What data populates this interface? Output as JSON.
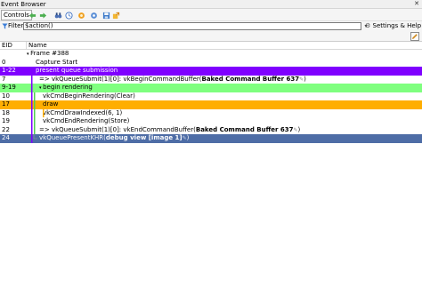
{
  "window": {
    "title": "Event Browser",
    "close_glyph": "✕"
  },
  "toolbar": {
    "controls_label": "Controls",
    "icons": [
      "arrow-left-icon",
      "arrow-right-icon",
      "binoculars-icon",
      "clock-icon",
      "bookmark-icon",
      "settings-icon",
      "save-icon",
      "export-icon"
    ]
  },
  "filter": {
    "label": "Filter",
    "value": "$action()",
    "settings_label": "Settings & Help"
  },
  "table": {
    "columns": [
      "EID",
      "Name"
    ],
    "rows": [
      {
        "eid": "",
        "name": "Frame #388",
        "indent": 1,
        "style": "normal",
        "expander": "▾"
      },
      {
        "eid": "0",
        "name": "Capture Start",
        "indent": 2,
        "style": "normal"
      },
      {
        "eid": "1-22",
        "name": "present queue submission",
        "indent": 2,
        "style": "purple"
      },
      {
        "eid": "7",
        "name": "=> vkQueueSubmit(1)[0]: vkBeginCommandBuffer(",
        "bold": "Baked Command Buffer 637",
        "tail": ")",
        "indent": 3,
        "style": "normal",
        "edit": "✎"
      },
      {
        "eid": "9-19",
        "name": "begin rendering",
        "indent": 3,
        "style": "green",
        "expander": "▾"
      },
      {
        "eid": "10",
        "name": "vkCmdBeginRendering(Clear)",
        "indent": 4,
        "style": "normal"
      },
      {
        "eid": "17",
        "name": "draw",
        "indent": 4,
        "style": "orange"
      },
      {
        "eid": "18",
        "name": "vkCmdDrawIndexed(6, 1)",
        "indent": 4,
        "style": "normal"
      },
      {
        "eid": "19",
        "name": "vkCmdEndRendering(Store)",
        "indent": 4,
        "style": "normal"
      },
      {
        "eid": "22",
        "name": "=> vkQueueSubmit(1)[0]: vkEndCommandBuffer(",
        "bold": "Baked Command Buffer 637",
        "tail": ")",
        "indent": 3,
        "style": "normal",
        "edit": "✎"
      },
      {
        "eid": "24",
        "name": "vkQueuePresentKHR(",
        "bold": "debug view [image 1]",
        "tail": ")",
        "indent": 3,
        "style": "selected",
        "edit": "✎"
      }
    ]
  },
  "colors": {
    "purple_marker": "#7f00ff",
    "green_marker": "#7fff7f",
    "orange_marker": "#ffae00",
    "selected_row": "#4e6da6"
  }
}
